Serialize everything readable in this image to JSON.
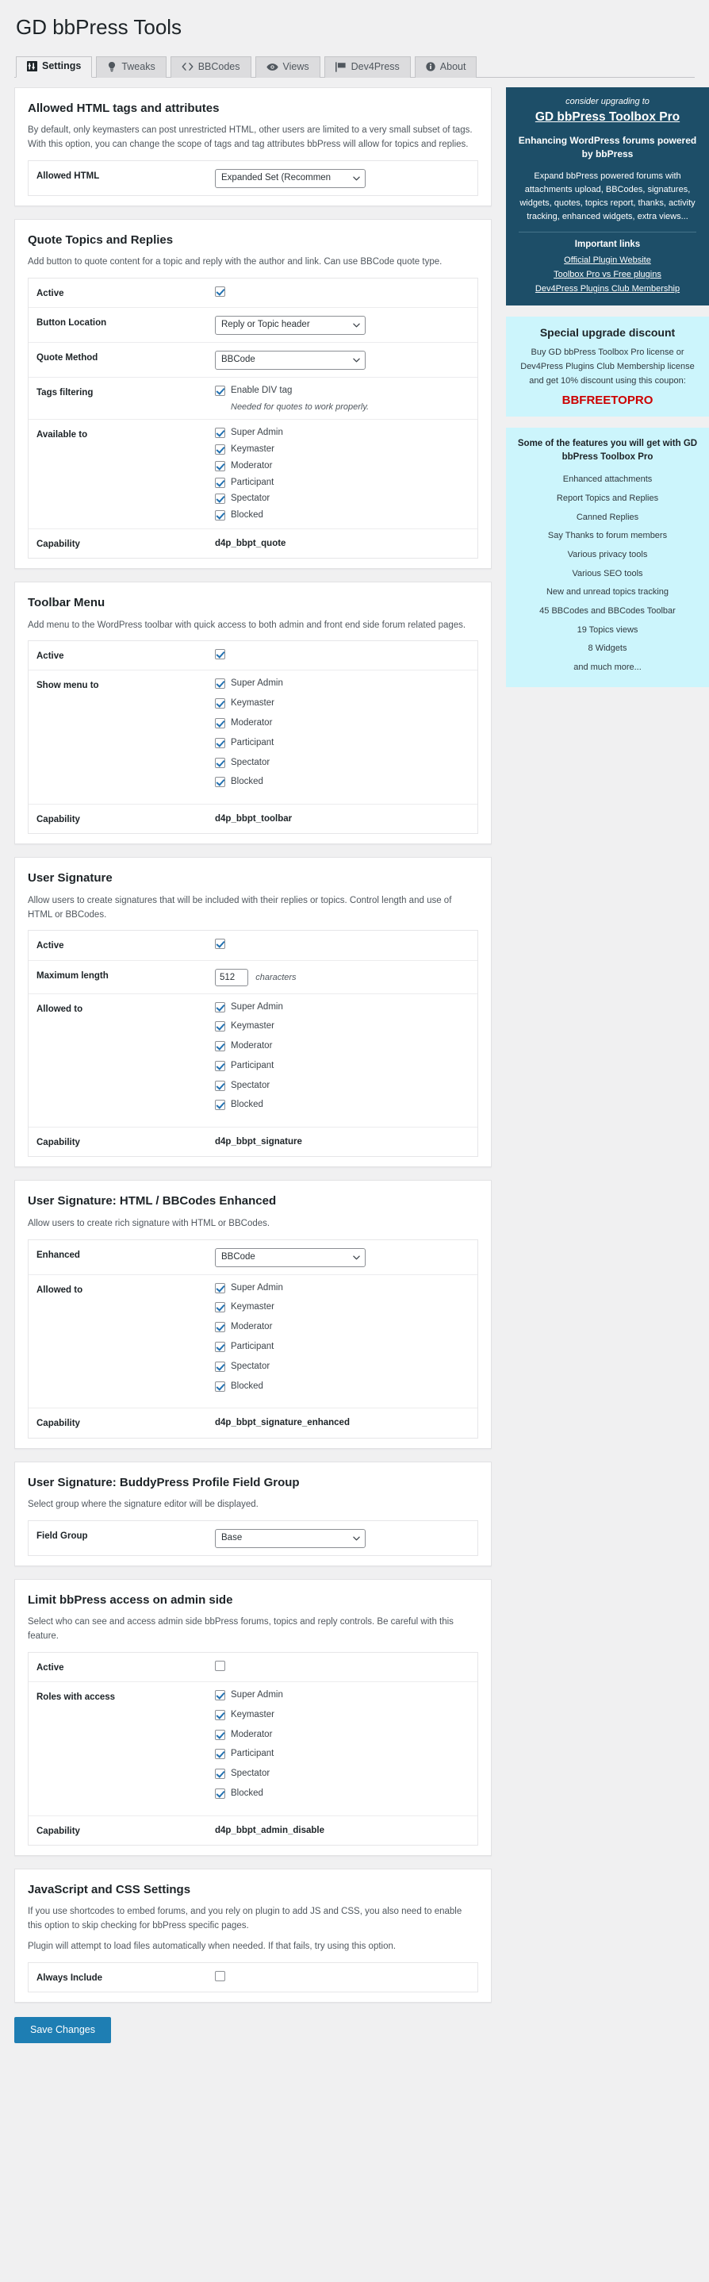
{
  "header": {
    "title": "GD bbPress Tools"
  },
  "tabs": [
    {
      "label": "Settings",
      "icon": "sliders-icon",
      "active": true
    },
    {
      "label": "Tweaks",
      "icon": "lightbulb-icon",
      "active": false
    },
    {
      "label": "BBCodes",
      "icon": "code-icon",
      "active": false
    },
    {
      "label": "Views",
      "icon": "eye-icon",
      "active": false
    },
    {
      "label": "Dev4Press",
      "icon": "flag-icon",
      "active": false
    },
    {
      "label": "About",
      "icon": "info-icon",
      "active": false
    }
  ],
  "roles": [
    "Super Admin",
    "Keymaster",
    "Moderator",
    "Participant",
    "Spectator",
    "Blocked"
  ],
  "sections": {
    "allowed_html": {
      "title": "Allowed HTML tags and attributes",
      "desc": "By default, only keymasters can post unrestricted HTML, other users are limited to a very small subset of tags. With this option, you can change the scope of tags and tag attributes bbPress will allow for topics and replies.",
      "field_label": "Allowed HTML",
      "value": "Expanded Set (Recommen"
    },
    "quote": {
      "title": "Quote Topics and Replies",
      "desc": "Add button to quote content for a topic and reply with the author and link. Can use BBCode quote type.",
      "active_label": "Active",
      "active_checked": true,
      "button_location_label": "Button Location",
      "button_location_value": "Reply or Topic header",
      "quote_method_label": "Quote Method",
      "quote_method_value": "BBCode",
      "tags_filtering_label": "Tags filtering",
      "tags_filtering_option": "Enable DIV tag",
      "tags_filtering_note": "Needed for quotes to work properly.",
      "available_to_label": "Available to",
      "capability_label": "Capability",
      "capability_value": "d4p_bbpt_quote"
    },
    "toolbar": {
      "title": "Toolbar Menu",
      "desc": "Add menu to the WordPress toolbar with quick access to both admin and front end side forum related pages.",
      "active_label": "Active",
      "active_checked": true,
      "show_menu_label": "Show menu to",
      "capability_label": "Capability",
      "capability_value": "d4p_bbpt_toolbar"
    },
    "signature": {
      "title": "User Signature",
      "desc": "Allow users to create signatures that will be included with their replies or topics. Control length and use of HTML or BBCodes.",
      "active_label": "Active",
      "active_checked": true,
      "max_length_label": "Maximum length",
      "max_length_value": "512",
      "max_length_suffix": "characters",
      "allowed_to_label": "Allowed to",
      "capability_label": "Capability",
      "capability_value": "d4p_bbpt_signature"
    },
    "signature_enhanced": {
      "title": "User Signature: HTML / BBCodes Enhanced",
      "desc": "Allow users to create rich signature with HTML or BBCodes.",
      "enhanced_label": "Enhanced",
      "enhanced_value": "BBCode",
      "allowed_to_label": "Allowed to",
      "capability_label": "Capability",
      "capability_value": "d4p_bbpt_signature_enhanced"
    },
    "buddypress": {
      "title": "User Signature: BuddyPress Profile Field Group",
      "desc": "Select group where the signature editor will be displayed.",
      "field_group_label": "Field Group",
      "field_group_value": "Base"
    },
    "limit_admin": {
      "title": "Limit bbPress access on admin side",
      "desc": "Select who can see and access admin side bbPress forums, topics and reply controls. Be careful with this feature.",
      "active_label": "Active",
      "active_checked": false,
      "roles_label": "Roles with access",
      "capability_label": "Capability",
      "capability_value": "d4p_bbpt_admin_disable"
    },
    "js_css": {
      "title": "JavaScript and CSS Settings",
      "desc1": "If you use shortcodes to embed forums, and you rely on plugin to add JS and CSS, you also need to enable this option to skip checking for bbPress specific pages.",
      "desc2": "Plugin will attempt to load files automatically when needed. If that fails, try using this option.",
      "always_include_label": "Always Include",
      "always_include_checked": false
    }
  },
  "save": {
    "label": "Save Changes"
  },
  "sidebar": {
    "promo": {
      "pre": "consider upgrading to",
      "title": "GD bbPress Toolbox Pro",
      "subtitle": "Enhancing WordPress forums powered by bbPress",
      "body": "Expand bbPress powered forums with attachments upload, BBCodes, signatures, widgets, quotes, topics report, thanks, activity tracking, enhanced widgets, extra views...",
      "links_head": "Important links",
      "links": [
        "Official Plugin Website",
        "Toolbox Pro vs Free plugins",
        "Dev4Press Plugins Club Membership"
      ]
    },
    "discount": {
      "title": "Special upgrade discount",
      "body": "Buy GD bbPress Toolbox Pro license or Dev4Press Plugins Club Membership license and get 10% discount using this coupon:",
      "coupon": "BBFREETOPRO"
    },
    "features": {
      "title": "Some of the features you will get with GD bbPress Toolbox Pro",
      "items": [
        "Enhanced attachments",
        "Report Topics and Replies",
        "Canned Replies",
        "Say Thanks to forum members",
        "Various privacy tools",
        "Various SEO tools",
        "New and unread topics tracking",
        "45 BBCodes and BBCodes Toolbar",
        "19 Topics views",
        "8 Widgets",
        "and much more..."
      ]
    }
  },
  "colors": {
    "promo_bg": "#1d4e68",
    "light_bg": "#ccf5fc",
    "coupon": "#cc0000",
    "accent": "#2271b1",
    "button": "#1e7eb3"
  }
}
